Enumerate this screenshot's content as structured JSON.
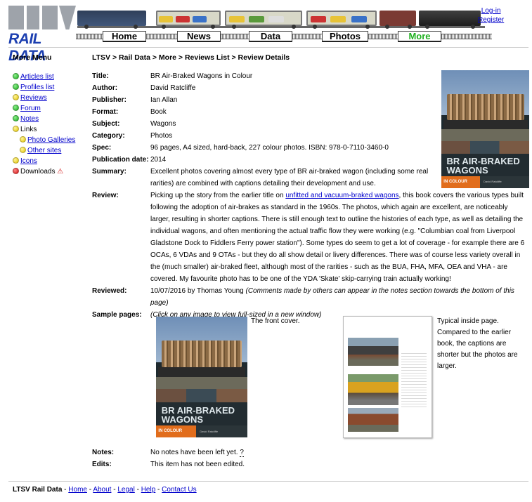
{
  "header": {
    "logo_text": "LTSV",
    "site_name": "RAIL DATA",
    "nav": [
      "Home",
      "News",
      "Data",
      "Photos",
      "More"
    ],
    "active_tab": "More",
    "login": "Log-in",
    "register": "Register"
  },
  "sidebar": {
    "title": "More Menu",
    "items": [
      {
        "label": "Articles list",
        "dot": "green",
        "link": true
      },
      {
        "label": "Profiles list",
        "dot": "green",
        "link": true
      },
      {
        "label": "Reviews",
        "dot": "yellow",
        "link": true
      },
      {
        "label": "Forum",
        "dot": "green",
        "link": true
      },
      {
        "label": "Notes",
        "dot": "green",
        "link": true
      },
      {
        "label": "Links",
        "dot": "yellow",
        "link": false
      },
      {
        "label": "Photo Galleries",
        "dot": "yellow",
        "link": true,
        "sub": true
      },
      {
        "label": "Other sites",
        "dot": "yellow",
        "link": true,
        "sub": true
      },
      {
        "label": "Icons",
        "dot": "yellow",
        "link": true
      },
      {
        "label": "Downloads",
        "dot": "red",
        "link": false,
        "warning": true
      }
    ]
  },
  "breadcrumb": "LTSV > Rail Data > More > Reviews List > Review Details",
  "details": {
    "labels": {
      "title": "Title:",
      "author": "Author:",
      "publisher": "Publisher:",
      "format": "Format:",
      "subject": "Subject:",
      "category": "Category:",
      "spec": "Spec:",
      "pubdate": "Publication date:",
      "summary": "Summary:",
      "review": "Review:",
      "reviewed": "Reviewed:",
      "sample": "Sample pages:",
      "notes": "Notes:",
      "edits": "Edits:"
    },
    "title": "BR Air-Braked Wagons in Colour",
    "author": "David Ratcliffe",
    "publisher": "Ian Allan",
    "format": "Book",
    "subject": "Wagons",
    "category": "Photos",
    "spec": "96 pages, A4 sized, hard-back, 227 colour photos. ISBN: 978-0-7110-3460-0",
    "pubdate": "2014",
    "summary": "Excellent photos covering almost every type of BR air-braked wagon (including some real rarities) are combined with captions detailing their development and use.",
    "review_pre": "Picking up the story from the earlier title on ",
    "review_link": "unfitted and vacuum-braked wagons",
    "review_post": ", this book covers the various types built following the adoption of air-brakes as standard in the 1960s. The photos, which again are excellent, are noticeably larger, resulting in shorter captions. There is still enough text to outline the histories of each type, as well as detailing the individual wagons, and often mentioning the actual traffic flow they were working (e.g. \"Columbian coal from Liverpool Gladstone Dock to Fiddlers Ferry power station\"). Some types do seem to get a lot of coverage - for example there are 6 OCAs, 6 VDAs and 9 OTAs - but they do all show detail or livery differences. There was of course less variety overall in the (much smaller) air-braked fleet, although most of the rarities - such as the BUA, FHA, MFA, OEA and VHA - are covered. My favourite photo has to be one of the YDA 'Skate' skip-carrying train actually working!",
    "reviewed_date": "10/07/2016 by Thomas Young",
    "reviewed_note": "(Comments made by others can appear in the notes section towards the bottom of this page)",
    "sample_hint": "(Click on any image to view full-sized in a new window)",
    "sample1_caption": "The front cover.",
    "sample2_caption": "Typical inside page. Compared to the earlier book, the captions are shorter but the photos are larger.",
    "notes": "No notes have been left yet.",
    "notes_help": "?",
    "edits": "This item has not been edited."
  },
  "cover": {
    "title_line1": "BR AIR-BRAKED",
    "title_line2": "WAGONS",
    "subtitle": "IN COLOUR",
    "author_small": "David Ratcliffe"
  },
  "footer": {
    "brand": "LTSV Rail Data",
    "links": [
      "Home",
      "About",
      "Legal",
      "Help",
      "Contact Us"
    ]
  },
  "colors": {
    "link": "#0000cc",
    "brand_blue": "#1c3fb0",
    "active_tab": "#1fb01f",
    "cover_orange": "#e16d1c"
  }
}
